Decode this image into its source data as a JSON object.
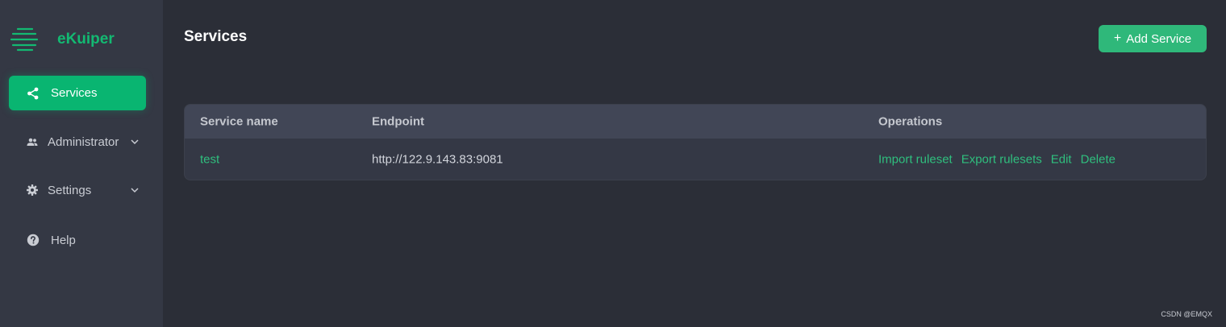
{
  "app": {
    "title": "eKuiper"
  },
  "sidebar": {
    "items": [
      {
        "label": "Services",
        "icon": "share-icon",
        "active": true
      },
      {
        "label": "Administrator",
        "icon": "users-icon",
        "expandable": true
      },
      {
        "label": "Settings",
        "icon": "gear-icon",
        "expandable": true
      },
      {
        "label": "Help",
        "icon": "help-icon"
      }
    ]
  },
  "main": {
    "title": "Services",
    "add_button_label": "Add Service",
    "table": {
      "columns": [
        "Service name",
        "Endpoint",
        "Operations"
      ],
      "rows": [
        {
          "name": "test",
          "endpoint": "http://122.9.143.83:9081",
          "operations": [
            "Import ruleset",
            "Export rulesets",
            "Edit",
            "Delete"
          ]
        }
      ]
    }
  },
  "watermark": "CSDN @EMQX",
  "colors": {
    "accent": "#09b571",
    "background": "#2b2e37",
    "sidebar": "#343844"
  }
}
